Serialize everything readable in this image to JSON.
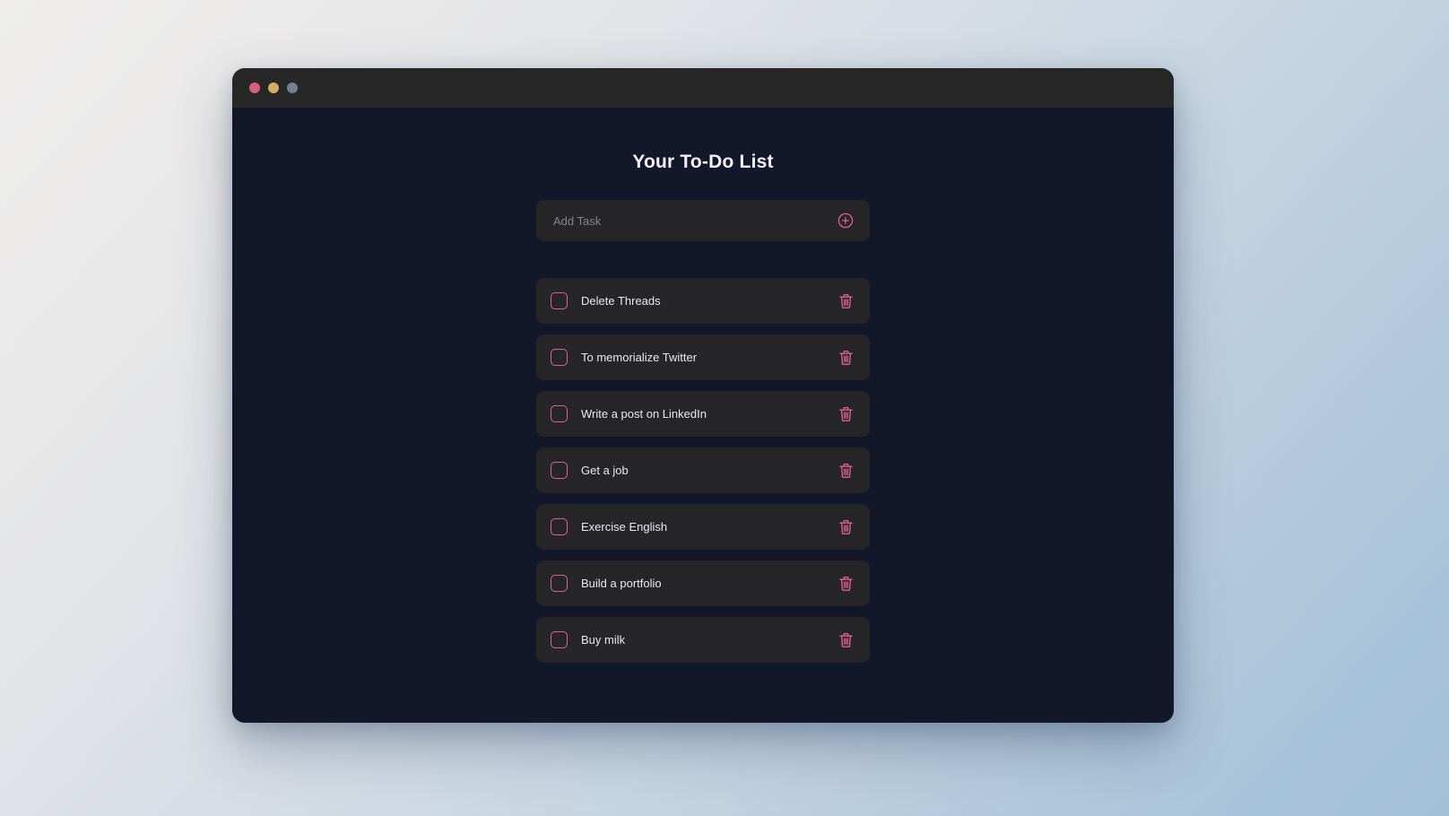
{
  "window": {
    "controls": [
      {
        "name": "close",
        "color": "#d8607f"
      },
      {
        "name": "minimize",
        "color": "#d9ab5e"
      },
      {
        "name": "maximize",
        "color": "#6f8193"
      }
    ]
  },
  "app": {
    "title": "Your To-Do List",
    "accent_color": "#e0628c",
    "background_color": "#121829",
    "card_color": "#262629"
  },
  "add_task": {
    "placeholder": "Add Task",
    "value": "",
    "button_icon": "plus-circle-icon"
  },
  "tasks": [
    {
      "label": "Delete Threads",
      "checked": false
    },
    {
      "label": "To memorialize Twitter",
      "checked": false
    },
    {
      "label": "Write a post on LinkedIn",
      "checked": false
    },
    {
      "label": "Get a job",
      "checked": false
    },
    {
      "label": "Exercise English",
      "checked": false
    },
    {
      "label": "Build a portfolio",
      "checked": false
    },
    {
      "label": "Buy milk",
      "checked": false
    }
  ],
  "icons": {
    "delete": "trash-icon",
    "checkbox": "checkbox-icon"
  }
}
